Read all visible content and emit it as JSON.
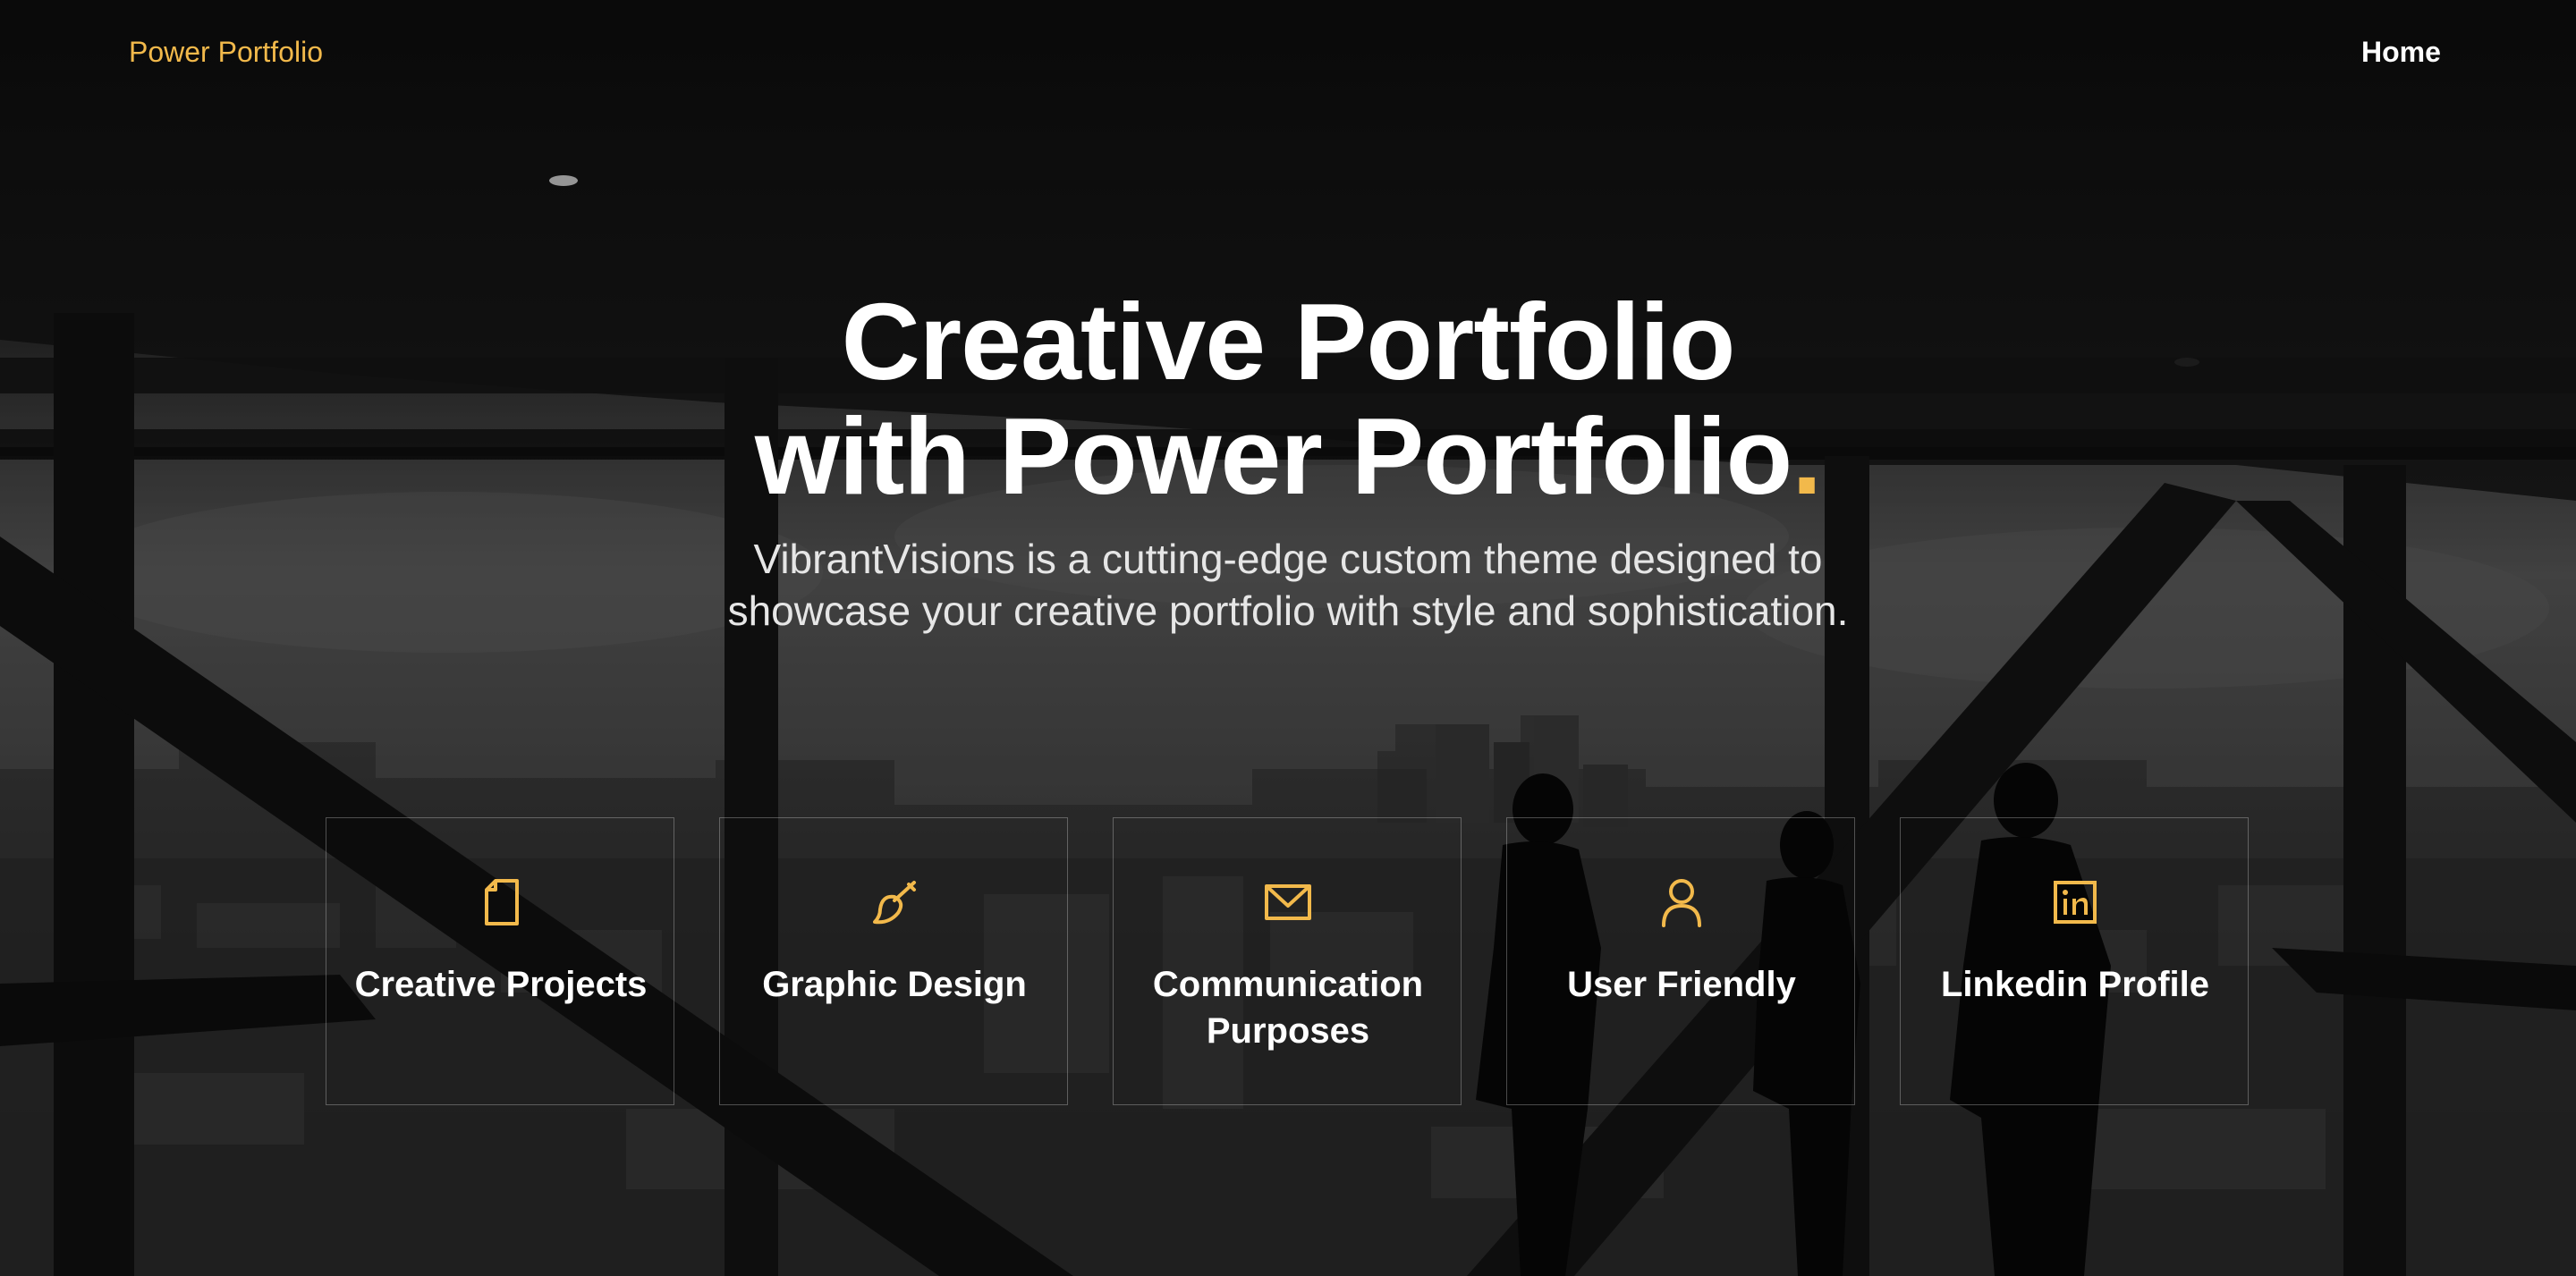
{
  "header": {
    "brand": "Power Portfolio",
    "nav": {
      "home": "Home"
    }
  },
  "hero": {
    "headline_line1": "Creative Portfolio",
    "headline_line2": "with Power Portfolio",
    "headline_dot": ".",
    "tagline": "VibrantVisions is a cutting-edge custom theme designed to showcase your creative portfolio with style and sophistication.",
    "background": "grayscale city skyline through office windows with silhouettes of people"
  },
  "features": [
    {
      "label": "Creative Projects",
      "icon": "document-icon"
    },
    {
      "label": "Graphic Design",
      "icon": "brush-icon"
    },
    {
      "label": "Communication Purposes",
      "icon": "envelope-icon"
    },
    {
      "label": "User Friendly",
      "icon": "user-icon"
    },
    {
      "label": "Linkedin Profile",
      "icon": "linkedin-icon"
    }
  ],
  "colors": {
    "accent": "#f2b94b",
    "text": "#ffffff",
    "card_border": "rgba(255,255,255,0.28)"
  }
}
